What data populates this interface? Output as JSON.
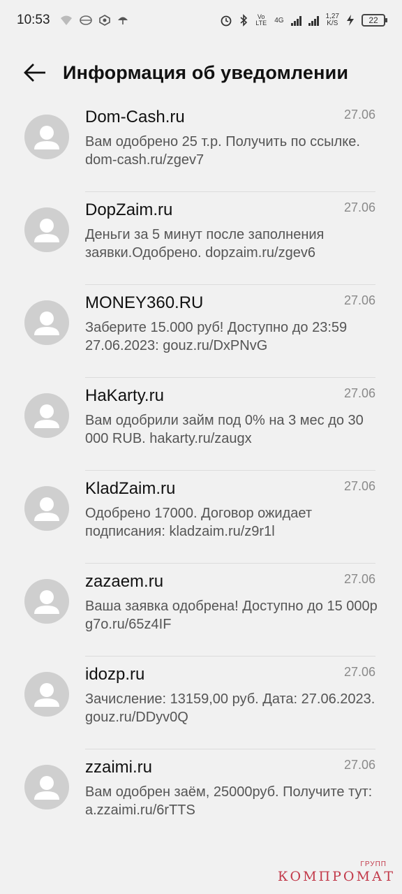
{
  "status_bar": {
    "time": "10:53",
    "net_speed_top": "1,27",
    "net_speed_bottom": "K/S",
    "network": "4G",
    "volte": "Vo LTE",
    "battery": "22"
  },
  "header": {
    "title": "Информация об уведомлении"
  },
  "messages": [
    {
      "sender": "Dom-Cash.ru",
      "date": "27.06",
      "text": "Вам одобрено 25 т.р. Получить по ссылке. dom-cash.ru/zgev7"
    },
    {
      "sender": "DopZaim.ru",
      "date": "27.06",
      "text": "Деньги за 5 минут после заполнения заявки.Одобрено. dopzaim.ru/zgev6"
    },
    {
      "sender": "MONEY360.RU",
      "date": "27.06",
      "text": "Заберите 15.000 руб! Доступно до 23:59 27.06.2023: gouz.ru/DxPNvG"
    },
    {
      "sender": "HaKarty.ru",
      "date": "27.06",
      "text": "Вам одобрили займ под 0% на 3 мес до 30 000 RUB. hakarty.ru/zaugx"
    },
    {
      "sender": "KladZaim.ru",
      "date": "27.06",
      "text": "Одобрено 17000. Договор ожидает подписания: kladzaim.ru/z9r1l"
    },
    {
      "sender": "zazaem.ru",
      "date": "27.06",
      "text": "Ваша заявка одобрена! Доступно до 15 000р g7o.ru/65z4IF"
    },
    {
      "sender": "idozp.ru",
      "date": "27.06",
      "text": "Зачисление: 13159,00 руб. Дата: 27.06.2023. gouz.ru/DDyv0Q"
    },
    {
      "sender": "zzaimi.ru",
      "date": "27.06",
      "text": "Вам одобрен заём, 25000руб. Получите тут: a.zzaimi.ru/6rTTS"
    }
  ],
  "watermark": {
    "small": "ГРУПП",
    "main": "КОМПРОМАТ"
  },
  "colors": {
    "background": "#f1f1f1",
    "avatar": "#cfcfcf",
    "watermark": "#c23a4a"
  }
}
